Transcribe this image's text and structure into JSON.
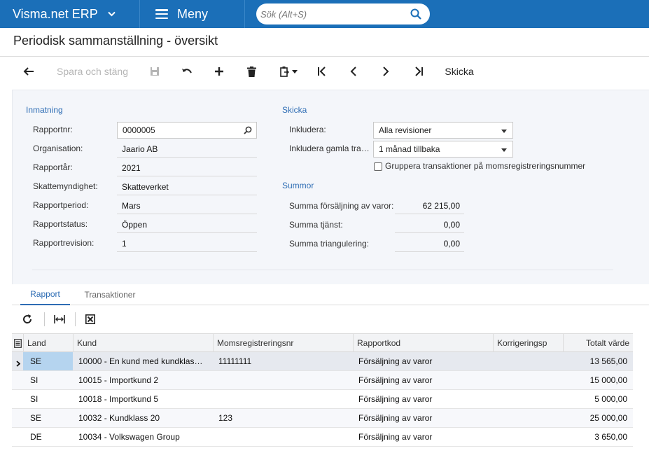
{
  "app": {
    "brand": "Visma.net ERP",
    "menu_label": "Meny",
    "search_placeholder": "Sök (Alt+S)"
  },
  "page": {
    "title": "Periodisk sammanställning - översikt"
  },
  "toolbar": {
    "save_close_label": "Spara och stäng",
    "send_label": "Skicka"
  },
  "inmatning": {
    "title": "Inmatning",
    "fields": [
      {
        "label": "Rapportnr:",
        "value": "0000005"
      },
      {
        "label": "Organisation:",
        "value": "Jaario AB"
      },
      {
        "label": "Rapportår:",
        "value": "2021"
      },
      {
        "label": "Skattemyndighet:",
        "value": "Skatteverket"
      },
      {
        "label": "Rapportperiod:",
        "value": "Mars"
      },
      {
        "label": "Rapportstatus:",
        "value": "Öppen"
      },
      {
        "label": "Rapportrevision:",
        "value": "1"
      }
    ]
  },
  "skicka": {
    "title": "Skicka",
    "include_label": "Inkludera:",
    "include_value": "Alla revisioner",
    "include_old_label": "Inkludera gamla tra…",
    "include_old_value": "1 månad tillbaka",
    "group_checkbox_label": "Gruppera transaktioner på momsregistreringsnummer",
    "group_checked": false
  },
  "summor": {
    "title": "Summor",
    "items": [
      {
        "label": "Summa försäljning av varor:",
        "value": "62 215,00"
      },
      {
        "label": "Summa tjänst:",
        "value": "0,00"
      },
      {
        "label": "Summa triangulering:",
        "value": "0,00"
      }
    ]
  },
  "tabs": [
    {
      "label": "Rapport",
      "active": true
    },
    {
      "label": "Transaktioner",
      "active": false
    }
  ],
  "grid": {
    "columns": [
      "Land",
      "Kund",
      "Momsregistreringsnr",
      "Rapportkod",
      "Korrigeringsp",
      "Totalt värde"
    ],
    "rows": [
      {
        "land": "SE",
        "kund": "10000 - En kund med kundklas…",
        "moms": "11111111",
        "kod": "Försäljning av varor",
        "korr": "",
        "total": "13 565,00"
      },
      {
        "land": "SI",
        "kund": "10015 - Importkund 2",
        "moms": "",
        "kod": "Försäljning av varor",
        "korr": "",
        "total": "15 000,00"
      },
      {
        "land": "SI",
        "kund": "10018 - Importkund 5",
        "moms": "",
        "kod": "Försäljning av varor",
        "korr": "",
        "total": "5 000,00"
      },
      {
        "land": "SE",
        "kund": "10032 - Kundklass 20",
        "moms": "123",
        "kod": "Försäljning av varor",
        "korr": "",
        "total": "25 000,00"
      },
      {
        "land": "DE",
        "kund": "10034 - Volkswagen Group",
        "moms": "",
        "kod": "Försäljning av varor",
        "korr": "",
        "total": "3 650,00"
      }
    ]
  },
  "colors": {
    "topbar": "#1b6fb8",
    "accent": "#2e6db4",
    "form_bg": "#f4f6fa",
    "selected_cell": "#b5d4ef"
  }
}
